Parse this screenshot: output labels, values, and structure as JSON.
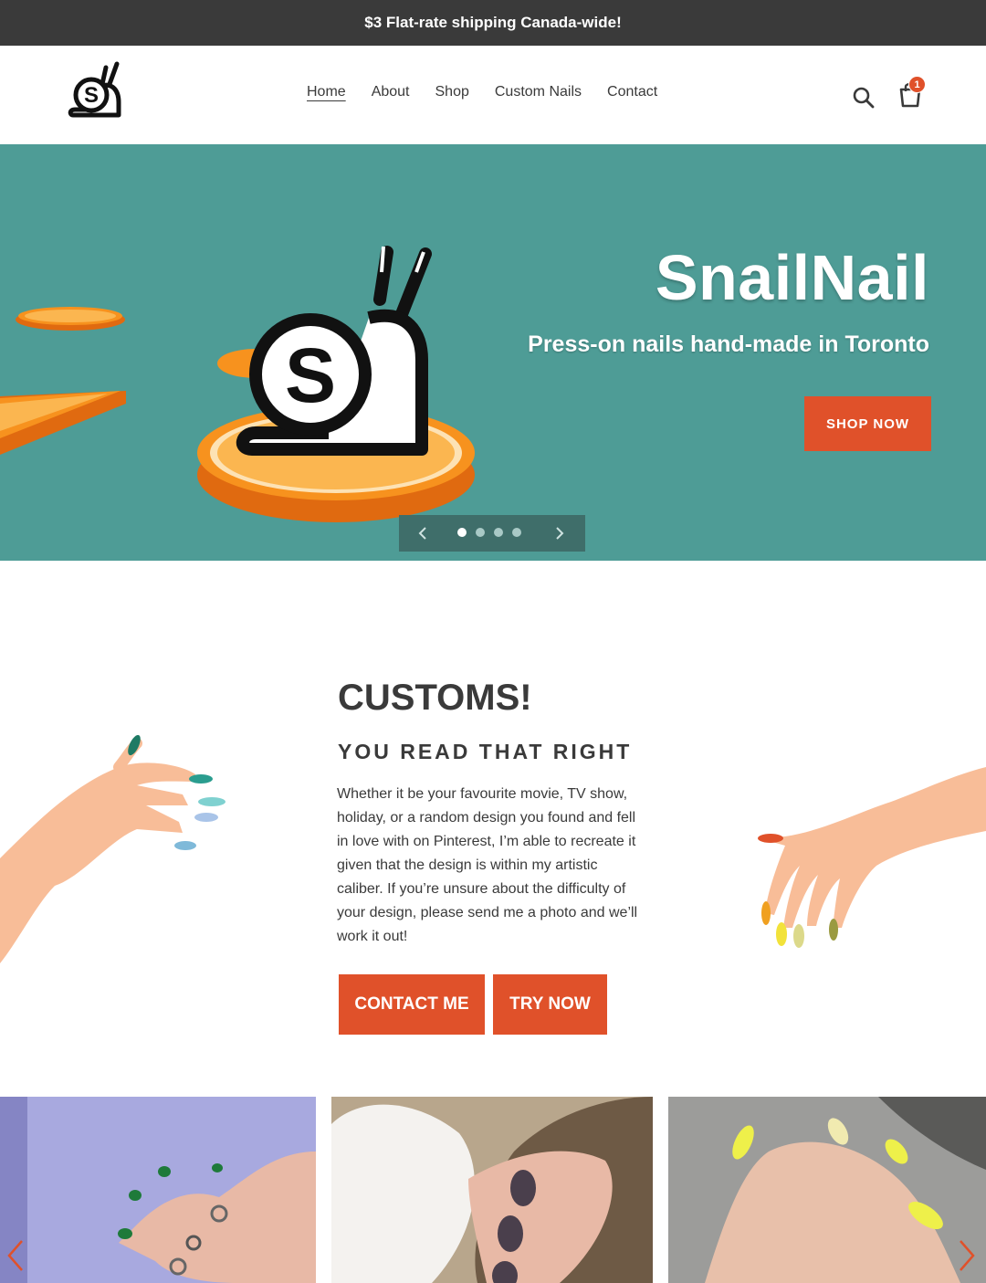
{
  "announcement": "$3 Flat-rate shipping Canada-wide!",
  "nav": {
    "items": [
      "Home",
      "About",
      "Shop",
      "Custom Nails",
      "Contact"
    ],
    "active": "Home"
  },
  "header": {
    "cart_count": "1",
    "icons": [
      "search-icon",
      "cart-icon"
    ]
  },
  "hero": {
    "title": "SnailNail",
    "subtitle": "Press-on nails hand-made in Toronto",
    "cta": "SHOP NOW",
    "slides": 4,
    "active_slide": 1
  },
  "customs": {
    "title": "CUSTOMS!",
    "subtitle": "YOU READ THAT RIGHT",
    "body": "Whether it be your favourite movie, TV show, holiday, or a random design you found and fell in love with on Pinterest, I’m able to recreate it given that the design is within my artistic caliber. If you’re unsure about the difficulty of your design, please send me a photo and we’ll work it out!",
    "buttons": [
      "CONTACT ME",
      "TRY NOW"
    ]
  },
  "colors": {
    "accent": "#e0512a",
    "hero_bg": "#4e9c96",
    "announcement_bg": "#3a3a3a",
    "text": "#3a3a3a"
  }
}
